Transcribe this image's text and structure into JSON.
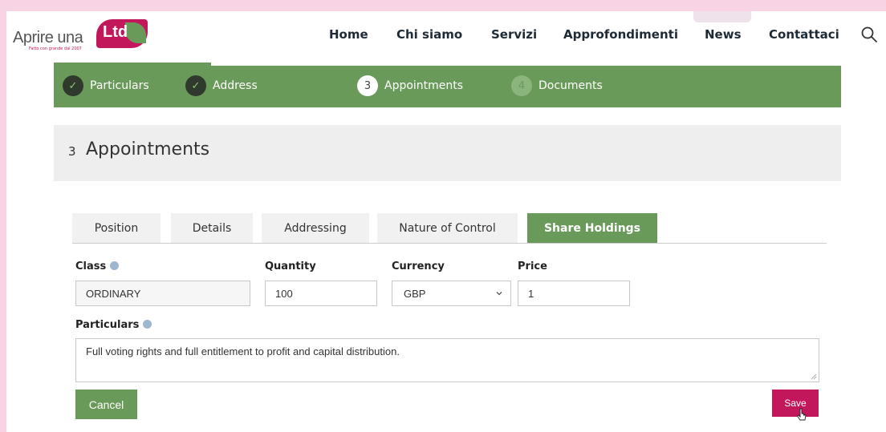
{
  "logo": {
    "text": "Aprire una",
    "badge": "Ltd",
    "tagline": "Fatto con grande dal 2007"
  },
  "nav": {
    "items": [
      {
        "label": "Home"
      },
      {
        "label": "Chi siamo"
      },
      {
        "label": "Servizi"
      },
      {
        "label": "Approfondimenti"
      },
      {
        "label": "News"
      },
      {
        "label": "Contattaci"
      }
    ],
    "search_icon": "search-icon"
  },
  "stepper": {
    "steps": [
      {
        "label": "Particulars",
        "state": "done",
        "marker": "✓"
      },
      {
        "label": "Address",
        "state": "done",
        "marker": "✓"
      },
      {
        "label": "Appointments",
        "state": "active",
        "marker": "3"
      },
      {
        "label": "Documents",
        "state": "todo",
        "marker": "4"
      }
    ]
  },
  "page": {
    "step_number": "3",
    "title": "Appointments"
  },
  "tabs": [
    {
      "label": "Position"
    },
    {
      "label": "Details"
    },
    {
      "label": "Addressing"
    },
    {
      "label": "Nature of Control"
    },
    {
      "label": "Share Holdings",
      "active": true
    }
  ],
  "form": {
    "class": {
      "label": "Class",
      "value": "ORDINARY"
    },
    "quantity": {
      "label": "Quantity",
      "value": "100"
    },
    "currency": {
      "label": "Currency",
      "value": "GBP"
    },
    "price": {
      "label": "Price",
      "value": "1"
    },
    "particulars": {
      "label": "Particulars",
      "value": "Full voting rights and full entitlement to profit and capital distribution."
    }
  },
  "buttons": {
    "cancel": "Cancel",
    "save": "Save"
  },
  "colors": {
    "green": "#6a9a59",
    "pink": "#c2185b",
    "background": "#f8d3e3"
  }
}
